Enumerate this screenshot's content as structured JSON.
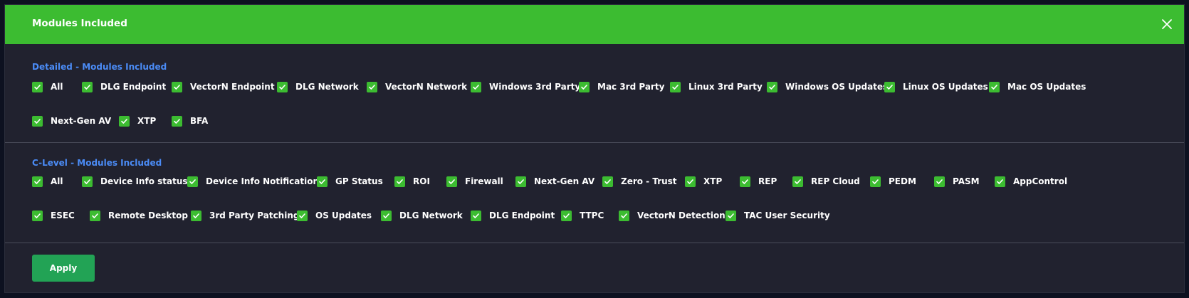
{
  "modal": {
    "title": "Modules Included",
    "close_icon": "close-icon",
    "accent_color": "#3cbc31",
    "link_color": "#4b8cf7"
  },
  "detailed": {
    "title": "Detailed - Modules Included",
    "items": [
      {
        "label": "All",
        "checked": true
      },
      {
        "label": "DLG Endpoint",
        "checked": true
      },
      {
        "label": "VectorN Endpoint",
        "checked": true
      },
      {
        "label": "DLG Network",
        "checked": true
      },
      {
        "label": "VectorN Network",
        "checked": true
      },
      {
        "label": "Windows 3rd Party",
        "checked": true
      },
      {
        "label": "Mac 3rd Party",
        "checked": true
      },
      {
        "label": "Linux 3rd Party",
        "checked": true
      },
      {
        "label": "Windows OS Updates",
        "checked": true
      },
      {
        "label": "Linux OS Updates",
        "checked": true
      },
      {
        "label": "Mac OS Updates",
        "checked": true
      },
      {
        "label": "Next-Gen AV",
        "checked": true
      },
      {
        "label": "XTP",
        "checked": true
      },
      {
        "label": "BFA",
        "checked": true
      }
    ]
  },
  "clevel": {
    "title": "C-Level - Modules Included",
    "items": [
      {
        "label": "All",
        "checked": true
      },
      {
        "label": "Device Info status",
        "checked": true
      },
      {
        "label": "Device Info Notifications",
        "checked": true
      },
      {
        "label": "GP Status",
        "checked": true
      },
      {
        "label": "ROI",
        "checked": true
      },
      {
        "label": "Firewall",
        "checked": true
      },
      {
        "label": "Next-Gen AV",
        "checked": true
      },
      {
        "label": "Zero - Trust",
        "checked": true
      },
      {
        "label": "XTP",
        "checked": true
      },
      {
        "label": "REP",
        "checked": true
      },
      {
        "label": "REP Cloud",
        "checked": true
      },
      {
        "label": "PEDM",
        "checked": true
      },
      {
        "label": "PASM",
        "checked": true
      },
      {
        "label": "AppControl",
        "checked": true
      },
      {
        "label": "ESEC",
        "checked": true
      },
      {
        "label": "Remote Desktop",
        "checked": true
      },
      {
        "label": "3rd Party Patching",
        "checked": true
      },
      {
        "label": "OS Updates",
        "checked": true
      },
      {
        "label": "DLG Network",
        "checked": true
      },
      {
        "label": "DLG Endpoint",
        "checked": true
      },
      {
        "label": "TTPC",
        "checked": true
      },
      {
        "label": "VectorN Detection",
        "checked": true
      },
      {
        "label": "TAC User Security",
        "checked": true
      }
    ]
  },
  "footer": {
    "apply_label": "Apply"
  }
}
